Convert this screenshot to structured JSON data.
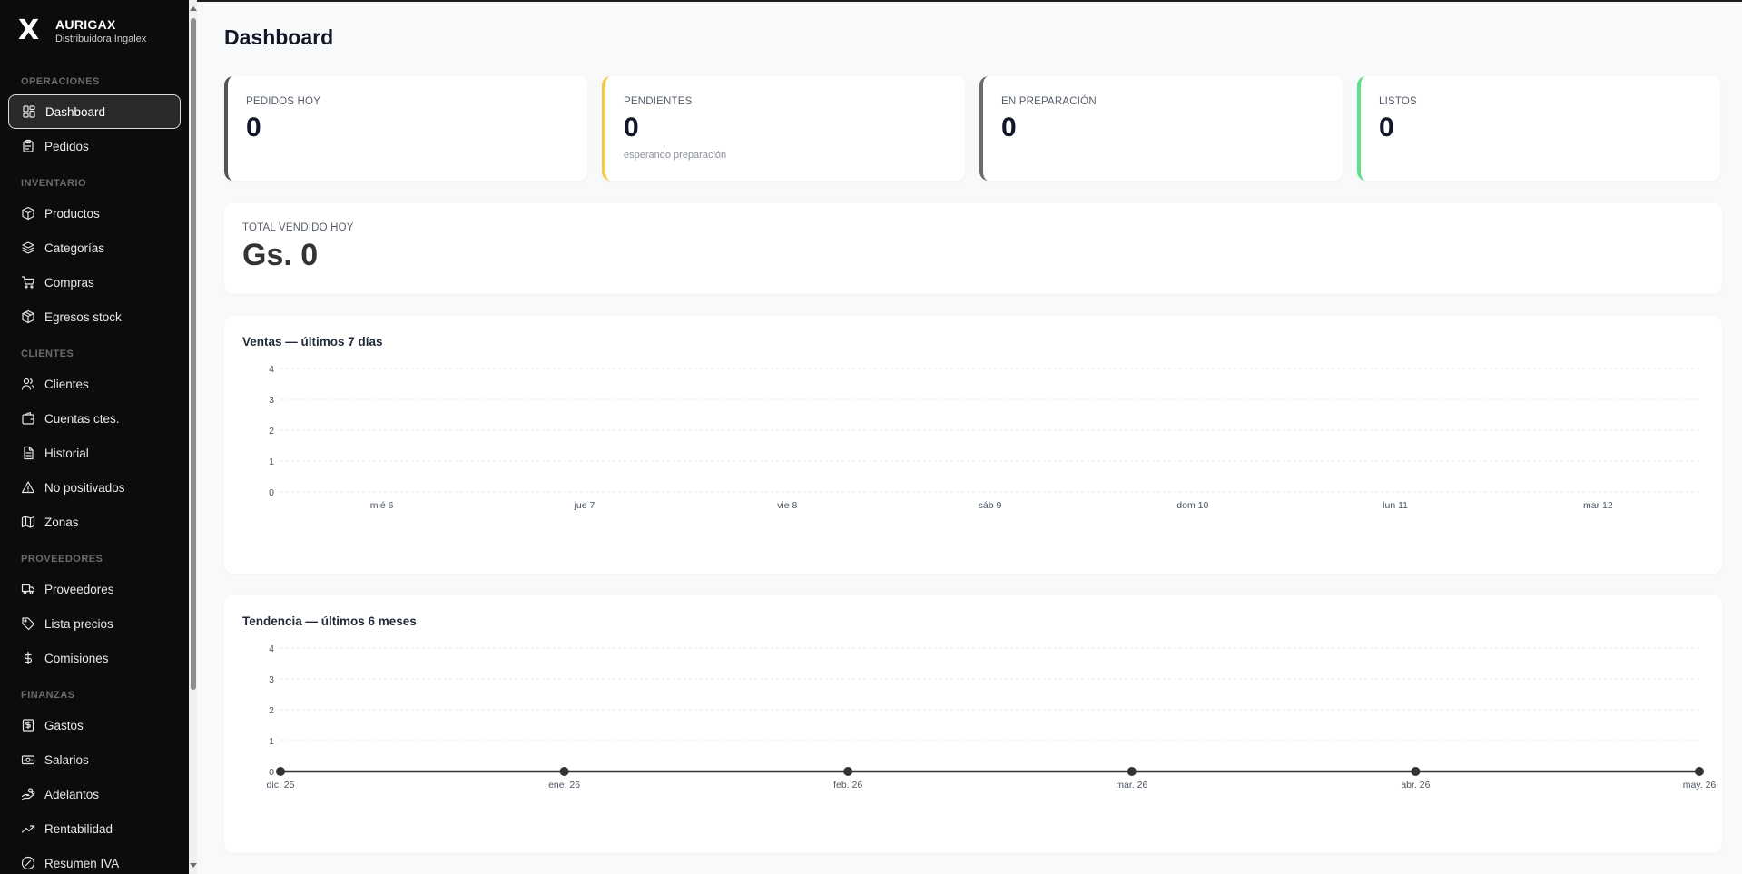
{
  "brand": {
    "logo": "X",
    "name": "AURIGAX",
    "subtitle": "Distribuidora Ingalex"
  },
  "sidebar": {
    "sections": [
      {
        "title": "OPERACIONES",
        "items": [
          {
            "label": "Dashboard",
            "icon": "dashboard-icon",
            "active": true
          },
          {
            "label": "Pedidos",
            "icon": "clipboard-icon"
          }
        ]
      },
      {
        "title": "INVENTARIO",
        "items": [
          {
            "label": "Productos",
            "icon": "package-icon"
          },
          {
            "label": "Categorías",
            "icon": "layers-icon"
          },
          {
            "label": "Compras",
            "icon": "cart-icon"
          },
          {
            "label": "Egresos stock",
            "icon": "package-out-icon"
          }
        ]
      },
      {
        "title": "CLIENTES",
        "items": [
          {
            "label": "Clientes",
            "icon": "users-icon"
          },
          {
            "label": "Cuentas ctes.",
            "icon": "wallet-icon"
          },
          {
            "label": "Historial",
            "icon": "file-icon"
          },
          {
            "label": "No positivados",
            "icon": "alert-icon"
          },
          {
            "label": "Zonas",
            "icon": "map-icon"
          }
        ]
      },
      {
        "title": "PROVEEDORES",
        "items": [
          {
            "label": "Proveedores",
            "icon": "truck-icon"
          },
          {
            "label": "Lista precios",
            "icon": "tag-icon"
          },
          {
            "label": "Comisiones",
            "icon": "dollar-icon"
          }
        ]
      },
      {
        "title": "FINANZAS",
        "items": [
          {
            "label": "Gastos",
            "icon": "receipt-icon"
          },
          {
            "label": "Salarios",
            "icon": "banknote-icon"
          },
          {
            "label": "Adelantos",
            "icon": "hand-coins-icon"
          },
          {
            "label": "Rentabilidad",
            "icon": "trending-up-icon"
          },
          {
            "label": "Resumen IVA",
            "icon": "percent-icon"
          }
        ]
      }
    ]
  },
  "page": {
    "title": "Dashboard"
  },
  "stats": [
    {
      "label": "PEDIDOS HOY",
      "value": "0",
      "sub": "",
      "accent": "#555555"
    },
    {
      "label": "PENDIENTES",
      "value": "0",
      "sub": "esperando preparación",
      "accent": "#f2c94c"
    },
    {
      "label": "EN PREPARACIÓN",
      "value": "0",
      "sub": "",
      "accent": "#6b6b6b"
    },
    {
      "label": "LISTOS",
      "value": "0",
      "sub": "",
      "accent": "#5ee08a"
    }
  ],
  "total": {
    "label": "TOTAL VENDIDO HOY",
    "value": "Gs. 0"
  },
  "chart_data": [
    {
      "type": "bar",
      "title": "Ventas — últimos 7 días",
      "categories": [
        "mié 6",
        "jue 7",
        "vie 8",
        "sáb 9",
        "dom 10",
        "lun 11",
        "mar 12"
      ],
      "values": [
        0,
        0,
        0,
        0,
        0,
        0,
        0
      ],
      "ylim": [
        0,
        4
      ],
      "yticks": [
        0,
        1,
        2,
        3,
        4
      ],
      "grid": true
    },
    {
      "type": "line",
      "title": "Tendencia — últimos 6 meses",
      "categories": [
        "dic. 25",
        "ene. 26",
        "feb. 26",
        "mar. 26",
        "abr. 26",
        "may. 26"
      ],
      "values": [
        0,
        0,
        0,
        0,
        0,
        0
      ],
      "ylim": [
        0,
        4
      ],
      "yticks": [
        0,
        1,
        2,
        3,
        4
      ],
      "grid": true,
      "line_color": "#333333"
    }
  ]
}
